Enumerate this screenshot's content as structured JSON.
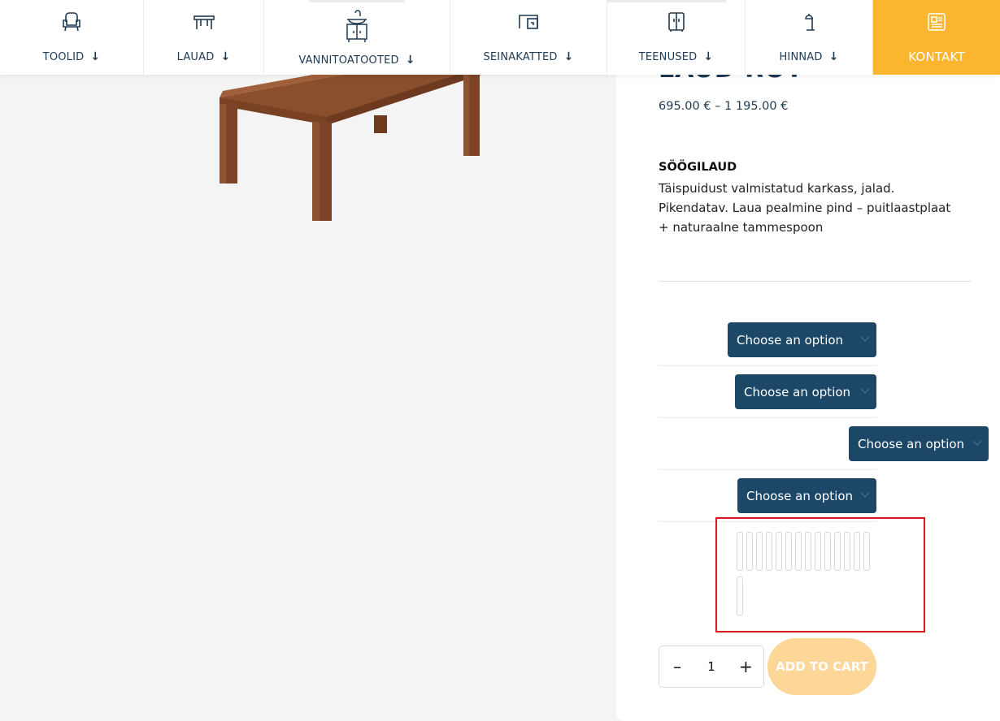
{
  "nav": {
    "items": [
      {
        "label": "TOOLID",
        "icon": "armchair-icon"
      },
      {
        "label": "LAUAD",
        "icon": "table-icon"
      },
      {
        "label": "VANNITOATOOTED",
        "icon": "vanity-sink-icon"
      },
      {
        "label": "SEINAKATTED",
        "icon": "wall-panel-icon"
      },
      {
        "label": "TEENUSED",
        "icon": "cabinet-icon"
      },
      {
        "label": "HINNAD",
        "icon": "lamp-icon"
      }
    ],
    "contact_label": "KONTAKT",
    "contact_icon": "newspaper-icon",
    "accent_color": "#fbb52f"
  },
  "product": {
    "title": "LAUD ROT",
    "price": "695.00 € – 1 195.00 €",
    "desc_heading": "SÖÖGILAUD",
    "desc_text": "Täispuidust valmistatud karkass, jalad. Pikendatav. Laua pealmine pind – puitlaastplaat + naturaalne tammespoon"
  },
  "variations": [
    {
      "value": "Choose an option"
    },
    {
      "value": "Choose an option"
    },
    {
      "value": "Choose an option"
    },
    {
      "value": "Choose an option"
    }
  ],
  "quantity": {
    "minus": "–",
    "value": "1",
    "plus": "+"
  },
  "cart": {
    "label": "ADD TO CART"
  },
  "colors": {
    "select_bg": "#1c4766",
    "cart_bg": "#fcd798",
    "text": "#1f3a52"
  }
}
